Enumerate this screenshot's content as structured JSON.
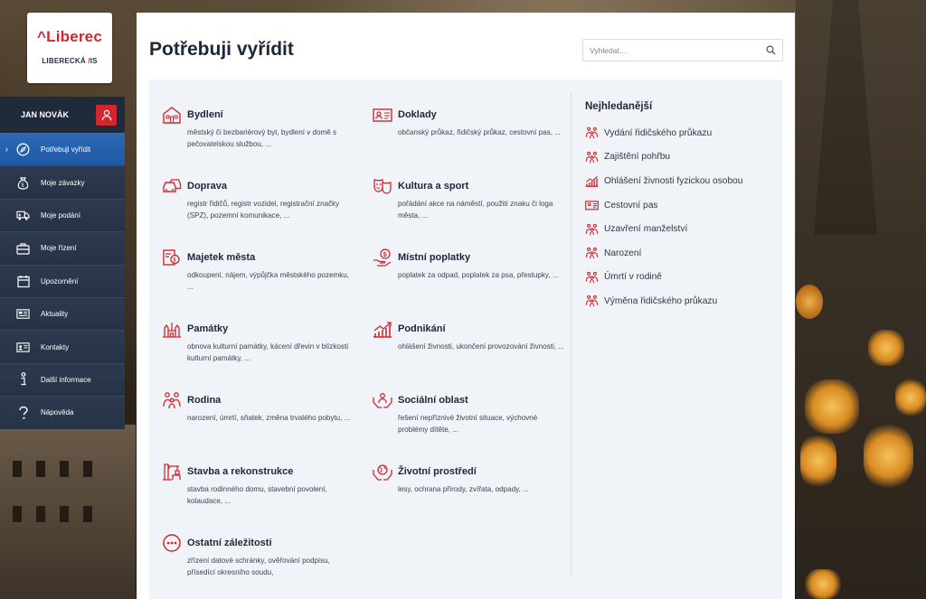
{
  "brand": {
    "logo_text": "Liberec",
    "logo_sub_left": "LIBERECKÁ",
    "logo_sub_right": "IS"
  },
  "user": {
    "name": "JAN NOVÁK"
  },
  "sidebar": {
    "items": [
      {
        "label": "Potřebuji vyřídit",
        "icon": "compass-icon",
        "active": true
      },
      {
        "label": "Moje závazky",
        "icon": "money-bag-icon"
      },
      {
        "label": "Moje podání",
        "icon": "truck-icon"
      },
      {
        "label": "Moje řízení",
        "icon": "briefcase-icon"
      },
      {
        "label": "Upozornění",
        "icon": "calendar-icon"
      },
      {
        "label": "Aktuality",
        "icon": "newspaper-icon"
      },
      {
        "label": "Kontakty",
        "icon": "contact-card-icon"
      },
      {
        "label": "Další informace",
        "icon": "info-icon"
      },
      {
        "label": "Nápověda",
        "icon": "question-icon"
      }
    ]
  },
  "main": {
    "title": "Potřebuji vyřídit",
    "search": {
      "placeholder": "Vyhledat..."
    },
    "categories": [
      {
        "title": "Bydlení",
        "desc": "městský či bezbariérový byt, bydlení v domě s pečovatelskou službou, ...",
        "icon": "house-icon"
      },
      {
        "title": "Doklady",
        "desc": "občanský průkaz, řidičský průkaz, cestovní pas, ...",
        "icon": "id-card-icon"
      },
      {
        "title": "Doprava",
        "desc": "registr řidičů, registr vozidel, registrační značky (SPZ), pozemní komunikace, ...",
        "icon": "cars-icon"
      },
      {
        "title": "Kultura a sport",
        "desc": "pořádání akce na náměstí, použití znaku či loga města, ...",
        "icon": "theater-masks-icon"
      },
      {
        "title": "Majetek města",
        "desc": "odkoupení, nájem, výpůjčka městského pozemku, ...",
        "icon": "property-icon"
      },
      {
        "title": "Místní poplatky",
        "desc": "poplatek za odpad, poplatek za psa, přestupky, ...",
        "icon": "payment-icon"
      },
      {
        "title": "Památky",
        "desc": "obnova kulturní památky, kácení dřevin v blízkosti kulturní památky, ...",
        "icon": "monument-icon"
      },
      {
        "title": "Podnikání",
        "desc": "ohlášení živnosti, ukončení provozování živnosti, ...",
        "icon": "growth-chart-icon"
      },
      {
        "title": "Rodina",
        "desc": "narození, úmrtí, sňatek, změna trvalého pobytu, ...",
        "icon": "family-icon"
      },
      {
        "title": "Sociální oblast",
        "desc": "řešení nepříznivé životní situace, výchovné problémy dítěte, ...",
        "icon": "helping-hands-icon"
      },
      {
        "title": "Stavba a rekonstrukce",
        "desc": "stavba rodinného domu, stavební povolení, kolaudace, ...",
        "icon": "crane-icon"
      },
      {
        "title": "Životní prostředí",
        "desc": "lesy, ochrana přírody, zvířata, odpady, ...",
        "icon": "earth-hands-icon"
      },
      {
        "title": "Ostatní záležitosti",
        "desc": "zřízení datové schránky, ověřování podpisu, přísedící okresního soudu,",
        "icon": "more-icon"
      }
    ],
    "popular": {
      "title": "Nejhledanější",
      "items": [
        {
          "label": "Vydání řidičského průkazu",
          "icon": "family-icon"
        },
        {
          "label": "Zajištění pohřbu",
          "icon": "family-icon"
        },
        {
          "label": "Ohlášení živnosti fyzickou osobou",
          "icon": "growth-chart-icon"
        },
        {
          "label": "Cestovní pas",
          "icon": "id-card-icon"
        },
        {
          "label": "Uzavření manželství",
          "icon": "family-icon"
        },
        {
          "label": "Narození",
          "icon": "family-icon"
        },
        {
          "label": "Úmrtí v rodině",
          "icon": "family-icon"
        },
        {
          "label": "Výměna řidičského průkazu",
          "icon": "family-icon"
        }
      ]
    }
  },
  "colors": {
    "accent": "#d3262e",
    "sidebar": "#263246",
    "sidebar_active": "#2159a4",
    "content_bg": "#f0f3f8",
    "title": "#1c2838"
  }
}
